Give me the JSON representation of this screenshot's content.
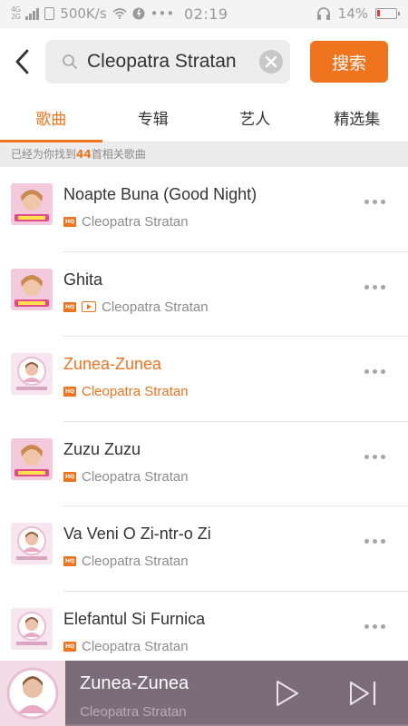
{
  "status_bar": {
    "network_left": "4G",
    "network_right": "2G",
    "speed": "500K/s",
    "dots": "•••",
    "time": "02:19",
    "battery": "14%",
    "battery_level": 0.14
  },
  "search": {
    "back_icon": "back-arrow-icon",
    "value": "Cleopatra Stratan",
    "placeholder": "",
    "button_label": "搜索",
    "accent": "#f0731e"
  },
  "tabs": [
    {
      "label": "歌曲",
      "active": true
    },
    {
      "label": "专辑",
      "active": false
    },
    {
      "label": "艺人",
      "active": false
    },
    {
      "label": "精选集",
      "active": false
    }
  ],
  "results": {
    "prefix": "已经为你找到",
    "count": "44",
    "suffix": "首相关歌曲"
  },
  "songs": [
    {
      "title": "Noapte Buna (Good Night)",
      "artist": "Cleopatra Stratan",
      "hq": true,
      "mv": false,
      "playing": false
    },
    {
      "title": "Ghita",
      "artist": "Cleopatra Stratan",
      "hq": true,
      "mv": true,
      "playing": false
    },
    {
      "title": "Zunea-Zunea",
      "artist": "Cleopatra Stratan",
      "hq": true,
      "mv": false,
      "playing": true
    },
    {
      "title": "Zuzu Zuzu",
      "artist": "Cleopatra Stratan",
      "hq": true,
      "mv": false,
      "playing": false
    },
    {
      "title": "Va Veni O Zi-ntr-o Zi",
      "artist": "Cleopatra Stratan",
      "hq": true,
      "mv": false,
      "playing": false
    },
    {
      "title": "Elefantul Si Furnica",
      "artist": "Cleopatra Stratan",
      "hq": true,
      "mv": false,
      "playing": false
    }
  ],
  "player": {
    "title": "Zunea-Zunea",
    "artist": "Cleopatra Stratan",
    "play_icon": "play-icon",
    "next_icon": "next-track-icon"
  }
}
